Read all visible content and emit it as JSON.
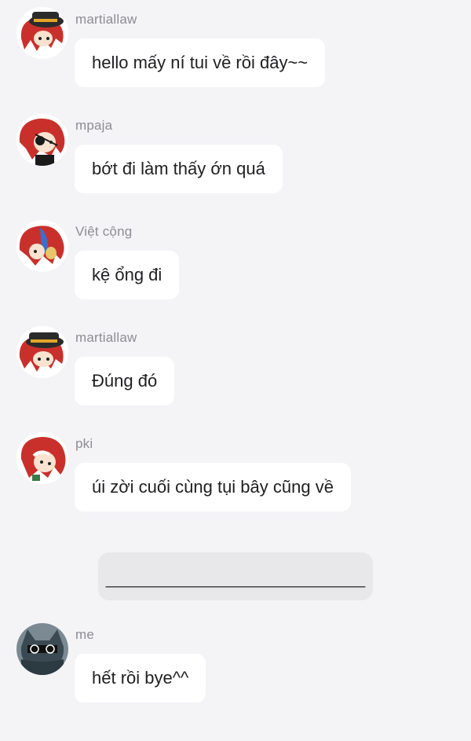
{
  "messages": [
    {
      "sender": "martiallaw",
      "text": "hello mấy ní tui về rồi đây~~",
      "avatar": "hat-avatar-icon"
    },
    {
      "sender": "mpaja",
      "text": "bớt đi làm thấy ớn quá",
      "avatar": "eyepatch-avatar-icon"
    },
    {
      "sender": "Việt cộng",
      "text": "kệ ổng đi",
      "avatar": "blue-hair-avatar-icon"
    },
    {
      "sender": "martiallaw",
      "text": "Đúng đó",
      "avatar": "hat-avatar-icon"
    },
    {
      "sender": "pki",
      "text": "úi zời cuối cùng tụi bây cũng về",
      "avatar": "red-hair-avatar-icon"
    }
  ],
  "divider": {
    "text": "___________________________"
  },
  "my_message": {
    "sender": "me",
    "text": "hết rồi bye^^",
    "avatar": "dark-cat-avatar-icon"
  },
  "colors": {
    "background": "#f4f4f7",
    "bubble": "#ffffff",
    "divider_box": "#e8e8eb",
    "sender_text": "#8d8d92",
    "message_text": "#1f1f22"
  }
}
